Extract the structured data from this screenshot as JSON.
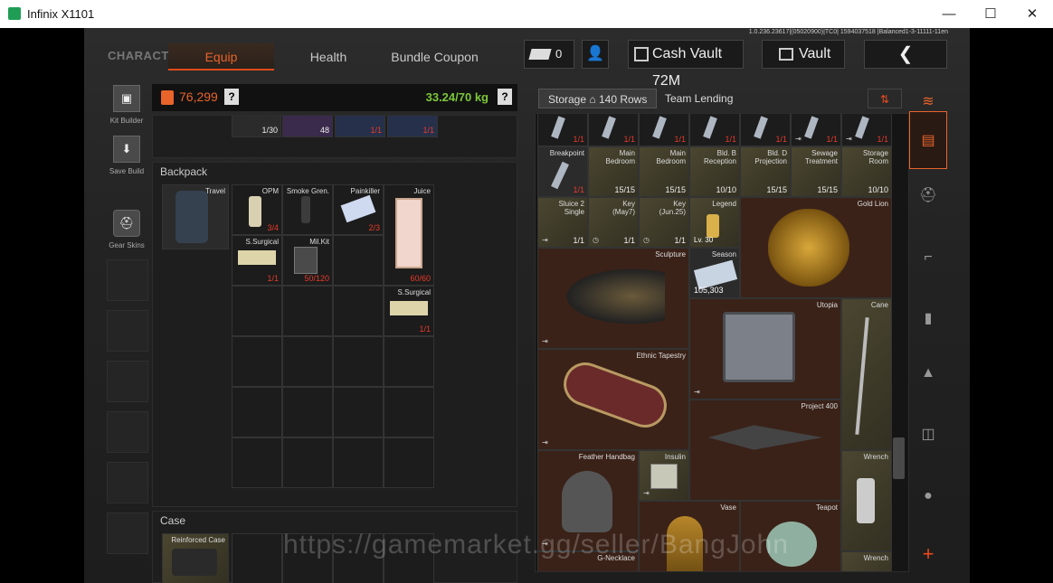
{
  "window": {
    "title": "Infinix X1101",
    "minimize": "—",
    "maximize": "☐",
    "close": "✕"
  },
  "version": "1.0.236.23617|(05020900)|TC0| 1594037518 |Balanced1-3-11111-11en",
  "nav": {
    "character": "CHARACTER",
    "tabs": [
      {
        "label": "Equip",
        "active": true
      },
      {
        "label": "Health"
      },
      {
        "label": "Bundle Coupon"
      }
    ],
    "ticket_count": "0",
    "cash_vault": "Cash Vault 72M",
    "vault": "Vault",
    "back": "❮"
  },
  "left_sidebar": [
    {
      "label": "Kit Builder"
    },
    {
      "label": "Save Build"
    },
    {
      "label": "Gear Skins"
    }
  ],
  "stats": {
    "money": "76,299",
    "weight": "33.24/70 kg",
    "help": "?"
  },
  "top_items": [
    {
      "count": "1/30"
    },
    {
      "count": "48"
    },
    {
      "count": "1/1"
    },
    {
      "count": "1/1"
    }
  ],
  "backpack": {
    "title": "Backpack",
    "bag_name": "Travel",
    "items": [
      {
        "name": "OPM",
        "count": "3/4"
      },
      {
        "name": "Smoke Gren.",
        "count": ""
      },
      {
        "name": "Painkiller",
        "count": "2/3"
      },
      {
        "name": "Juice",
        "count": "60/60"
      },
      {
        "name": "S.Surgical",
        "count": "1/1"
      },
      {
        "name": "Mil.Kit",
        "count": "50/120"
      },
      {
        "name": "S.Surgical",
        "count": "1/1"
      }
    ]
  },
  "case": {
    "title": "Case",
    "name": "Reinforced Case"
  },
  "storage": {
    "tab_storage": "Storage",
    "rows": "140 Rows",
    "tab_team": "Team Lending",
    "row1": [
      {
        "count": "1/1"
      },
      {
        "count": "1/1"
      },
      {
        "count": "1/1"
      },
      {
        "count": "1/1"
      },
      {
        "count": "1/1"
      },
      {
        "count": "1/1"
      },
      {
        "count": "1/1"
      }
    ],
    "row2": [
      {
        "name": "Breakpoint",
        "count": "1/1"
      },
      {
        "name": "Main Bedroom",
        "count": "15/15"
      },
      {
        "name": "Main Bedroom",
        "count": "15/15"
      },
      {
        "name": "Bld. B Reception",
        "count": "10/10"
      },
      {
        "name": "Bld. D Projection",
        "count": "15/15"
      },
      {
        "name": "Sewage Treatment",
        "count": "15/15"
      },
      {
        "name": "Storage Room",
        "count": "10/10"
      }
    ],
    "row3": [
      {
        "name": "Sluice 2 Single",
        "count": "1/1"
      },
      {
        "name": "Key (May7)",
        "count": "1/1"
      },
      {
        "name": "Key (Jun.25)",
        "count": "1/1"
      },
      {
        "name": "Legend",
        "count": "Lv. 30"
      }
    ],
    "big": [
      {
        "name": "Gold Lion"
      },
      {
        "name": "Sculpture"
      },
      {
        "name": "Season",
        "count": "105,303"
      },
      {
        "name": "Utopia"
      },
      {
        "name": "Cane"
      },
      {
        "name": "Ethnic Tapestry"
      },
      {
        "name": "Project 400"
      },
      {
        "name": "Feather Handbag"
      },
      {
        "name": "Insulin"
      },
      {
        "name": "Wrench"
      },
      {
        "name": "Vase"
      },
      {
        "name": "Teapot"
      },
      {
        "name": "G-Necklace"
      },
      {
        "name": "Wrench"
      }
    ]
  },
  "watermark": "https://gamemarket.gg/seller/BangJohn",
  "right_tabs": [
    {
      "icon": "storage-icon"
    },
    {
      "icon": "helmet-icon"
    },
    {
      "icon": "rifle-icon"
    },
    {
      "icon": "magazine-icon"
    },
    {
      "icon": "ammo-icon"
    },
    {
      "icon": "armor-icon"
    },
    {
      "icon": "grenade-icon"
    },
    {
      "icon": "plus-icon"
    }
  ]
}
